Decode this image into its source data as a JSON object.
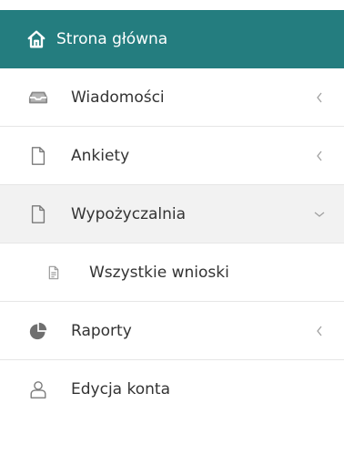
{
  "menu": {
    "items": [
      {
        "label": "Strona główna",
        "icon": "home-icon",
        "state": "active"
      },
      {
        "label": "Wiadomości",
        "icon": "inbox-icon",
        "chevron": "chevron-left-icon"
      },
      {
        "label": "Ankiety",
        "icon": "document-icon",
        "chevron": "chevron-left-icon"
      },
      {
        "label": "Wypożyczalnia",
        "icon": "document-icon",
        "chevron": "chevron-down-icon",
        "state": "expanded"
      },
      {
        "label": "Wszystkie wnioski",
        "icon": "file-text-icon",
        "state": "subitem"
      },
      {
        "label": "Raporty",
        "icon": "pie-chart-icon",
        "chevron": "chevron-left-icon"
      },
      {
        "label": "Edycja konta",
        "icon": "user-icon"
      }
    ]
  },
  "colors": {
    "active_bg": "#247d7f",
    "expanded_bg": "#f2f2f2",
    "text": "#333333",
    "muted_icon": "#9a9a9a"
  }
}
